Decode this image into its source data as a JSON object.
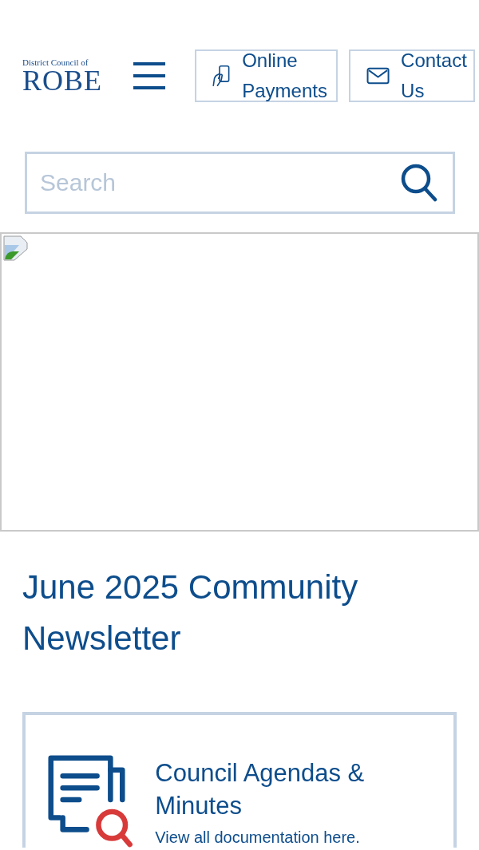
{
  "header": {
    "logo": {
      "top_line": "District Council of",
      "name": "ROBE"
    },
    "buttons": [
      {
        "kind": "payment",
        "label": "Online Payments"
      },
      {
        "kind": "mail",
        "label": "Contact Us"
      }
    ]
  },
  "search": {
    "placeholder": "Search"
  },
  "hero": {
    "kind": "broken-image"
  },
  "heading": "June 2025 Community Newsletter",
  "cards": [
    {
      "kind": "documents",
      "title": "Council Agendas & Minutes",
      "subtitle": "View all documentation here."
    }
  ]
}
